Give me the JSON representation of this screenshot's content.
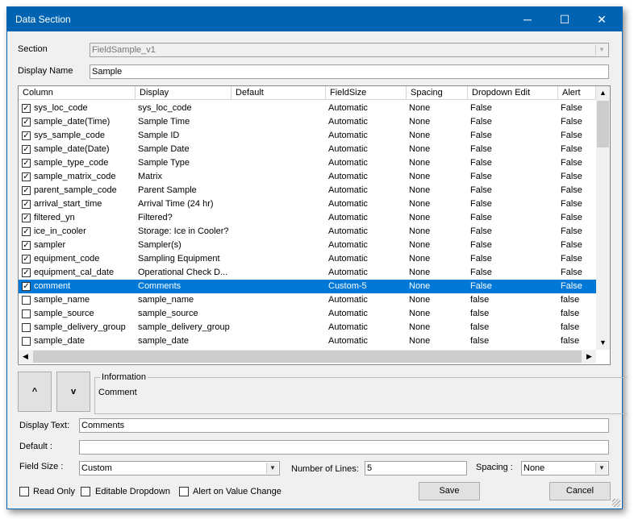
{
  "window": {
    "title": "Data Section",
    "minimize": "─",
    "maximize": "☐",
    "close": "✕"
  },
  "section": {
    "label": "Section",
    "value": "FieldSample_v1"
  },
  "display_name": {
    "label": "Display Name",
    "value": "Sample"
  },
  "grid": {
    "columns": [
      "Column",
      "Display",
      "Default",
      "FieldSize",
      "Spacing",
      "Dropdown Edit",
      "Alert"
    ],
    "rows": [
      {
        "checked": true,
        "column": "sys_loc_code",
        "display": "sys_loc_code",
        "default": "",
        "fieldsize": "Automatic",
        "spacing": "None",
        "dropdown": "False",
        "alert": "False"
      },
      {
        "checked": true,
        "column": "sample_date(Time)",
        "display": "Sample Time",
        "default": "",
        "fieldsize": "Automatic",
        "spacing": "None",
        "dropdown": "False",
        "alert": "False"
      },
      {
        "checked": true,
        "column": "sys_sample_code",
        "display": "Sample ID",
        "default": "",
        "fieldsize": "Automatic",
        "spacing": "None",
        "dropdown": "False",
        "alert": "False"
      },
      {
        "checked": true,
        "column": "sample_date(Date)",
        "display": "Sample Date",
        "default": "",
        "fieldsize": "Automatic",
        "spacing": "None",
        "dropdown": "False",
        "alert": "False"
      },
      {
        "checked": true,
        "column": "sample_type_code",
        "display": "Sample Type",
        "default": "",
        "fieldsize": "Automatic",
        "spacing": "None",
        "dropdown": "False",
        "alert": "False"
      },
      {
        "checked": true,
        "column": "sample_matrix_code",
        "display": "Matrix",
        "default": "",
        "fieldsize": "Automatic",
        "spacing": "None",
        "dropdown": "False",
        "alert": "False"
      },
      {
        "checked": true,
        "column": "parent_sample_code",
        "display": "Parent Sample",
        "default": "",
        "fieldsize": "Automatic",
        "spacing": "None",
        "dropdown": "False",
        "alert": "False"
      },
      {
        "checked": true,
        "column": "arrival_start_time",
        "display": "Arrival Time (24 hr)",
        "default": "",
        "fieldsize": "Automatic",
        "spacing": "None",
        "dropdown": "False",
        "alert": "False"
      },
      {
        "checked": true,
        "column": "filtered_yn",
        "display": "Filtered?",
        "default": "",
        "fieldsize": "Automatic",
        "spacing": "None",
        "dropdown": "False",
        "alert": "False"
      },
      {
        "checked": true,
        "column": "ice_in_cooler",
        "display": "Storage: Ice in Cooler?",
        "default": "",
        "fieldsize": "Automatic",
        "spacing": "None",
        "dropdown": "False",
        "alert": "False"
      },
      {
        "checked": true,
        "column": "sampler",
        "display": "Sampler(s)",
        "default": "",
        "fieldsize": "Automatic",
        "spacing": "None",
        "dropdown": "False",
        "alert": "False"
      },
      {
        "checked": true,
        "column": "equipment_code",
        "display": "Sampling Equipment",
        "default": "",
        "fieldsize": "Automatic",
        "spacing": "None",
        "dropdown": "False",
        "alert": "False"
      },
      {
        "checked": true,
        "column": "equipment_cal_date",
        "display": "Operational Check D...",
        "default": "",
        "fieldsize": "Automatic",
        "spacing": "None",
        "dropdown": "False",
        "alert": "False"
      },
      {
        "checked": true,
        "selected": true,
        "column": "comment",
        "display": "Comments",
        "default": "",
        "fieldsize": "Custom-5",
        "spacing": "None",
        "dropdown": "False",
        "alert": "False"
      },
      {
        "checked": false,
        "column": "sample_name",
        "display": "sample_name",
        "default": "",
        "fieldsize": "Automatic",
        "spacing": "None",
        "dropdown": "false",
        "alert": "false"
      },
      {
        "checked": false,
        "column": "sample_source",
        "display": "sample_source",
        "default": "",
        "fieldsize": "Automatic",
        "spacing": "None",
        "dropdown": "false",
        "alert": "false"
      },
      {
        "checked": false,
        "column": "sample_delivery_group",
        "display": "sample_delivery_group",
        "default": "",
        "fieldsize": "Automatic",
        "spacing": "None",
        "dropdown": "false",
        "alert": "false"
      },
      {
        "checked": false,
        "column": "sample_date",
        "display": "sample_date",
        "default": "",
        "fieldsize": "Automatic",
        "spacing": "None",
        "dropdown": "false",
        "alert": "false"
      }
    ]
  },
  "move_up": "^",
  "move_down": "v",
  "information": {
    "label": "Information",
    "text": "Comment"
  },
  "display_text": {
    "label": "Display Text:",
    "value": "Comments"
  },
  "default_field": {
    "label": "Default  :",
    "value": ""
  },
  "field_size": {
    "label": "Field Size :",
    "value": "Custom"
  },
  "number_of_lines": {
    "label": "Number of Lines:",
    "value": "5"
  },
  "spacing": {
    "label": "Spacing :",
    "value": "None"
  },
  "checkboxes": {
    "read_only": "Read Only",
    "editable_dropdown": "Editable Dropdown",
    "alert_on_change": "Alert on Value Change"
  },
  "save": "Save",
  "cancel": "Cancel",
  "colors": {
    "titlebar": "#0063b1",
    "selection": "#0078d7"
  }
}
